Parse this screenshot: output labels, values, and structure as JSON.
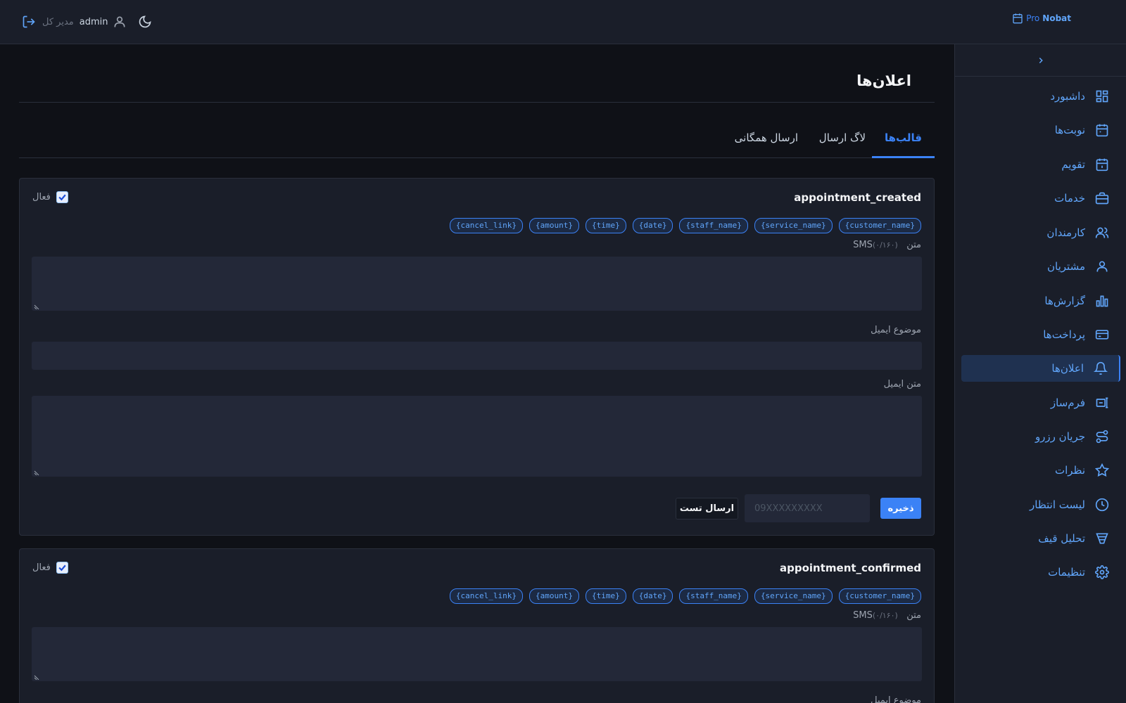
{
  "header": {
    "logo_pro": "Pro",
    "logo_nobat": "Nobat",
    "username": "admin",
    "role": "مدیر کل",
    "icons": [
      "calendar-icon",
      "logout-icon",
      "user-icon",
      "moon-icon"
    ]
  },
  "sidebar": {
    "items": [
      {
        "label": "داشبورد",
        "icon": "dashboard-icon"
      },
      {
        "label": "نوبت‌ها",
        "icon": "calendar-check-icon"
      },
      {
        "label": "تقویم",
        "icon": "calendar-icon"
      },
      {
        "label": "خدمات",
        "icon": "briefcase-icon"
      },
      {
        "label": "کارمندان",
        "icon": "users-icon"
      },
      {
        "label": "مشتریان",
        "icon": "user-icon"
      },
      {
        "label": "گزارش‌ها",
        "icon": "chart-icon"
      },
      {
        "label": "پرداخت‌ها",
        "icon": "credit-card-icon"
      },
      {
        "label": "اعلان‌ها",
        "icon": "bell-icon",
        "active": true
      },
      {
        "label": "فرم‌ساز",
        "icon": "form-builder-icon"
      },
      {
        "label": "جریان رزرو",
        "icon": "flow-icon"
      },
      {
        "label": "نظرات",
        "icon": "star-icon"
      },
      {
        "label": "لیست انتظار",
        "icon": "clock-icon"
      },
      {
        "label": "تحلیل قیف",
        "icon": "funnel-icon"
      },
      {
        "label": "تنظیمات",
        "icon": "gear-icon"
      }
    ]
  },
  "main": {
    "title": "اعلان‌ها",
    "tabs": [
      {
        "label": "قالب‌ها",
        "active": true
      },
      {
        "label": "لاگ ارسال"
      },
      {
        "label": "ارسال همگانی"
      }
    ]
  },
  "templates": [
    {
      "name": "appointment_created",
      "active_label": "فعال",
      "active": true,
      "variables": [
        "{customer_name}",
        "{service_name}",
        "{staff_name}",
        "{date}",
        "{time}",
        "{amount}",
        "{cancel_link}"
      ],
      "sms_label": "متن",
      "sms_count": "(۰/۱۶۰)",
      "sms_suffix": "SMS",
      "email_subject_label": "موضوع ایمیل",
      "email_body_label": "متن ایمیل",
      "save_label": "ذخیره",
      "phone_placeholder": "09XXXXXXXXX",
      "test_label": "ارسال تست"
    },
    {
      "name": "appointment_confirmed",
      "active_label": "فعال",
      "active": true,
      "variables": [
        "{customer_name}",
        "{service_name}",
        "{staff_name}",
        "{date}",
        "{time}",
        "{amount}",
        "{cancel_link}"
      ],
      "sms_label": "متن",
      "sms_count": "(۰/۱۶۰)",
      "sms_suffix": "SMS",
      "email_subject_label": "موضوع ایمیل"
    }
  ],
  "colors": {
    "accent": "#3b82f6",
    "background": "#0f1117",
    "panel": "#1a1e29"
  }
}
